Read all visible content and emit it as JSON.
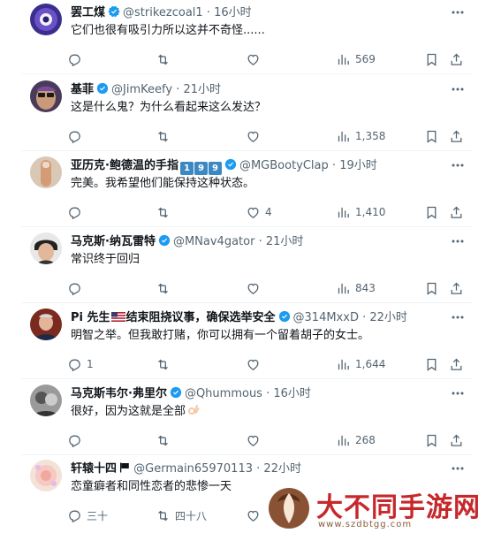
{
  "tweets": [
    {
      "name": "罢工煤",
      "handle": "@strikezcoal1",
      "time": "16小时",
      "text": "它们也很有吸引力所以这并不奇怪......",
      "replies": "",
      "retweets": "",
      "likes": "",
      "views": "569"
    },
    {
      "name": "基菲",
      "handle": "@JimKeefy",
      "time": "21小时",
      "text": "这是什么鬼？为什么看起来这么发达？",
      "replies": "",
      "retweets": "",
      "likes": "",
      "views": "1,358"
    },
    {
      "name": "亚历克·鲍德温的手指",
      "name_digits": [
        "1",
        "9",
        "9"
      ],
      "handle": "@MGBootyClap",
      "time": "19小时",
      "text": "完美。我希望他们能保持这种状态。",
      "replies": "",
      "retweets": "",
      "likes": "4",
      "views": "1,410"
    },
    {
      "name": "马克斯·纳瓦雷特",
      "handle": "@MNav4gator",
      "time": "21小时",
      "text": "常识终于回归",
      "replies": "",
      "retweets": "",
      "likes": "",
      "views": "843"
    },
    {
      "name_prefix": "Pi 先生",
      "name_suffix": "结束阻挠议事，确保选举安全",
      "handle": "@314MxxD",
      "time": "22小时",
      "text": "明智之举。但我敢打赌，你可以拥有一个留着胡子的女士。",
      "replies": "1",
      "retweets": "",
      "likes": "",
      "views": "1,644"
    },
    {
      "name": "马克斯韦尔·弗里尔",
      "handle": "@Qhummous",
      "time": "16小时",
      "text": "很好，因为这就是全部",
      "replies": "",
      "retweets": "",
      "likes": "",
      "views": "268"
    },
    {
      "name": "轩辕十四",
      "handle": "@Germain65970113",
      "time": "22小时",
      "text": "恋童癖者和同性恋者的悲惨一天",
      "replies": "三十",
      "retweets": "四十八",
      "likes": "",
      "views": ""
    }
  ],
  "separator": "·",
  "icons": {
    "verified": "verified-badge-icon",
    "more": "more-dots-icon",
    "reply": "reply-icon",
    "retweet": "retweet-icon",
    "like": "heart-icon",
    "views": "views-chart-icon",
    "bookmark": "bookmark-icon",
    "share": "share-icon"
  },
  "colors": {
    "verified": "#1d9bf0",
    "muted": "#536471",
    "text": "#0f1419",
    "divider": "#eff3f4",
    "watermark": "#c6282b"
  },
  "watermark": {
    "title": "大不同手游网",
    "url": "www.szdbtgg.com"
  }
}
